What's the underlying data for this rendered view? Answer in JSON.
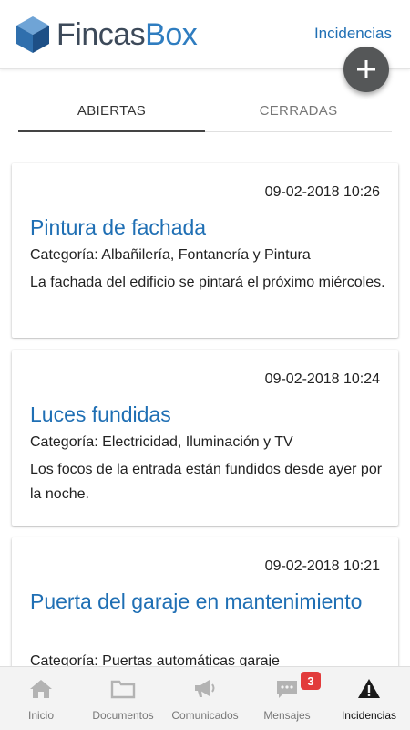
{
  "header": {
    "brand_part1": "Fincas",
    "brand_part2": "Box",
    "link_label": "Incidencias"
  },
  "fab": {
    "icon": "plus-icon"
  },
  "tabs": [
    {
      "label": "ABIERTAS",
      "active": true
    },
    {
      "label": "CERRADAS",
      "active": false
    }
  ],
  "incidents": [
    {
      "date": "09-02-2018 10:26",
      "title": "Pintura de fachada",
      "category": "Categoría: Albañilería, Fontanería y Pintura",
      "description": "La fachada del edificio se pintará el próximo miércoles."
    },
    {
      "date": "09-02-2018 10:24",
      "title": "Luces fundidas",
      "category": "Categoría: Electricidad, Iluminación y TV",
      "description": "Los focos de la entrada están fundidos desde ayer por la noche."
    },
    {
      "date": "09-02-2018 10:21",
      "title": "Puerta del garaje en mantenimiento",
      "category": "Categoría: Puertas automáticas garaje",
      "description": ""
    }
  ],
  "bottom_nav": [
    {
      "label": "Inicio",
      "icon": "home-icon",
      "active": false
    },
    {
      "label": "Documentos",
      "icon": "folder-icon",
      "active": false
    },
    {
      "label": "Comunicados",
      "icon": "megaphone-icon",
      "active": false
    },
    {
      "label": "Mensajes",
      "icon": "chat-icon",
      "active": false,
      "badge": "3"
    },
    {
      "label": "Incidencias",
      "icon": "warning-icon",
      "active": true
    }
  ],
  "colors": {
    "accent": "#1f6fb4",
    "fab": "#555758",
    "badge": "#e23b3b"
  }
}
